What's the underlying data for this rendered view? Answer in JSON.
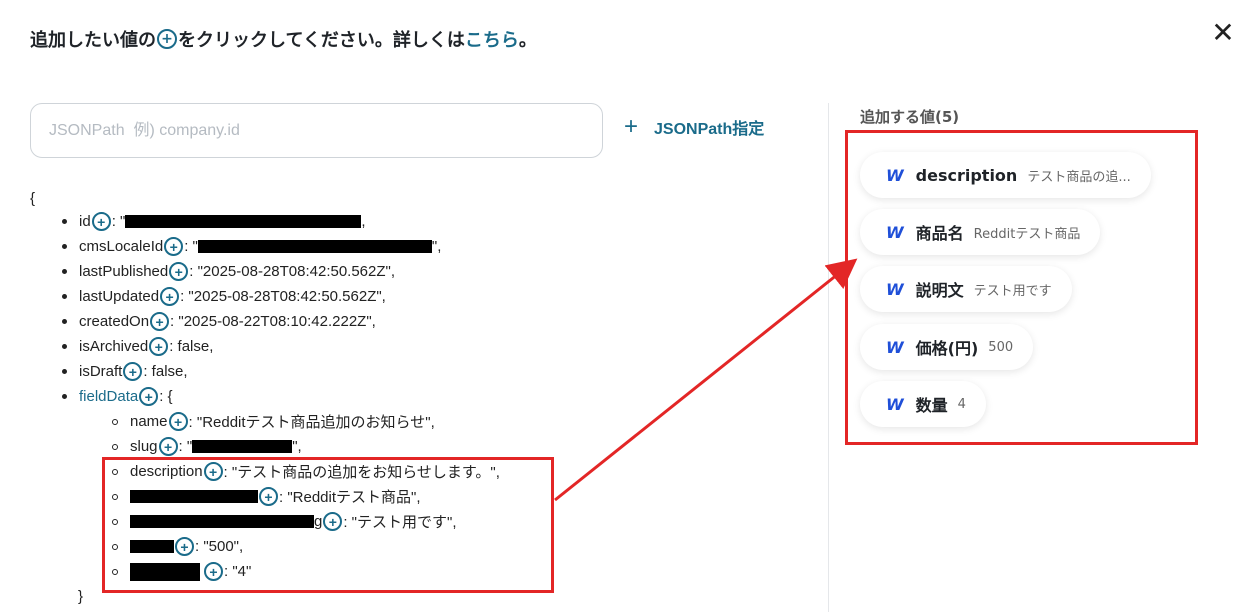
{
  "header": {
    "text_before": "追加したい値の",
    "text_after": "をクリックしてください。詳しくは",
    "link": "こちら",
    "end": "。"
  },
  "close_icon": "close-icon",
  "search": {
    "placeholder": "JSONPath  例) company.id",
    "value": ""
  },
  "jsonpath_button": {
    "label": "JSONPath指定"
  },
  "tree": {
    "open_brace": "{",
    "close_brace": "}",
    "items": [
      {
        "key": "id",
        "value": ": \"",
        "tail": ","
      },
      {
        "key": "cmsLocaleId",
        "value": ": \"",
        "tail": "\","
      },
      {
        "key": "lastPublished",
        "value": ": \"2025-08-28T08:42:50.562Z\","
      },
      {
        "key": "lastUpdated",
        "value": ": \"2025-08-28T08:42:50.562Z\","
      },
      {
        "key": "createdOn",
        "value": ": \"2025-08-22T08:10:42.222Z\","
      },
      {
        "key": "isArchived",
        "value": ": false,"
      },
      {
        "key": "isDraft",
        "value": ": false,"
      },
      {
        "key": "fieldData",
        "value": ": {"
      }
    ],
    "field_items": [
      {
        "key": "name",
        "value": ": \"Redditテスト商品追加のお知らせ\","
      },
      {
        "key": "slug",
        "value": ": \"",
        "tail": "\","
      },
      {
        "key": "description",
        "value": ": \"テスト商品の追加をお知らせします。\","
      },
      {
        "key": "",
        "value": ": \"Redditテスト商品\","
      },
      {
        "key": "g",
        "value": ": \"テスト用です\","
      },
      {
        "key": "",
        "value": ": \"500\","
      },
      {
        "key": "",
        "value": ": \"4\""
      }
    ]
  },
  "right_panel": {
    "title": "追加する値(5)",
    "chips": [
      {
        "name": "description",
        "value": "テスト商品の追...",
        "icon": "webflow-icon"
      },
      {
        "name": "商品名",
        "value": "Redditテスト商品",
        "icon": "webflow-icon"
      },
      {
        "name": "説明文",
        "value": "テスト用です",
        "icon": "webflow-icon"
      },
      {
        "name": "価格(円)",
        "value": "500",
        "icon": "webflow-icon"
      },
      {
        "name": "数量",
        "value": "4",
        "icon": "webflow-icon"
      }
    ]
  },
  "colors": {
    "accent": "#1a6b8a",
    "highlight": "#e32626",
    "webflow": "#1f4fd8"
  }
}
